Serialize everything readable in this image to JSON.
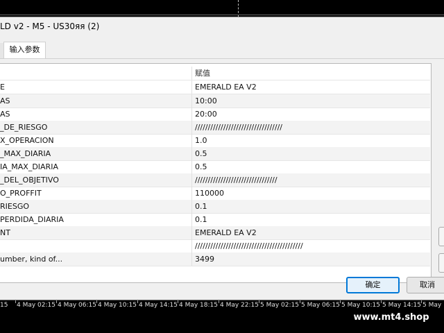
{
  "window": {
    "title": "LD v2 - M5 - US30яя (2)"
  },
  "tabs": [
    {
      "label": "输入参数"
    }
  ],
  "table": {
    "value_header": "赋值",
    "rows": [
      {
        "name": "E",
        "value": "EMERALD EA V2"
      },
      {
        "name": "AS",
        "value": "10:00"
      },
      {
        "name": "AS",
        "value": "20:00"
      },
      {
        "name": "_DE_RIESGO",
        "value": "//////////////////////////////////"
      },
      {
        "name": "X_OPERACION",
        "value": "1.0"
      },
      {
        "name": "_MAX_DIARIA",
        "value": "0.5"
      },
      {
        "name": "IA_MAX_DIARIA",
        "value": "0.5"
      },
      {
        "name": "_DEL_OBJETIVO",
        "value": "////////////////////////////////"
      },
      {
        "name": "O_PROFFIT",
        "value": "110000"
      },
      {
        "name": "RIESGO",
        "value": "0.1"
      },
      {
        "name": "PERDIDA_DIARIA",
        "value": "0.1"
      },
      {
        "name": "NT",
        "value": "EMERALD EA V2"
      },
      {
        "name": "",
        "value": "//////////////////////////////////////////"
      },
      {
        "name": "umber, kind of...",
        "value": "3499"
      }
    ]
  },
  "buttons": {
    "ok_label": "确定",
    "cancel_label": "取消"
  },
  "timeline": {
    "ticks": [
      "15",
      "4 May 02:15",
      "4 May 06:15",
      "4 May 10:15",
      "4 May 14:15",
      "4 May 18:15",
      "4 May 22:15",
      "5 May 02:15",
      "5 May 06:15",
      "5 May 10:15",
      "5 May 14:15",
      "5 May 18:15"
    ]
  },
  "watermark": "www.mt4.shop"
}
